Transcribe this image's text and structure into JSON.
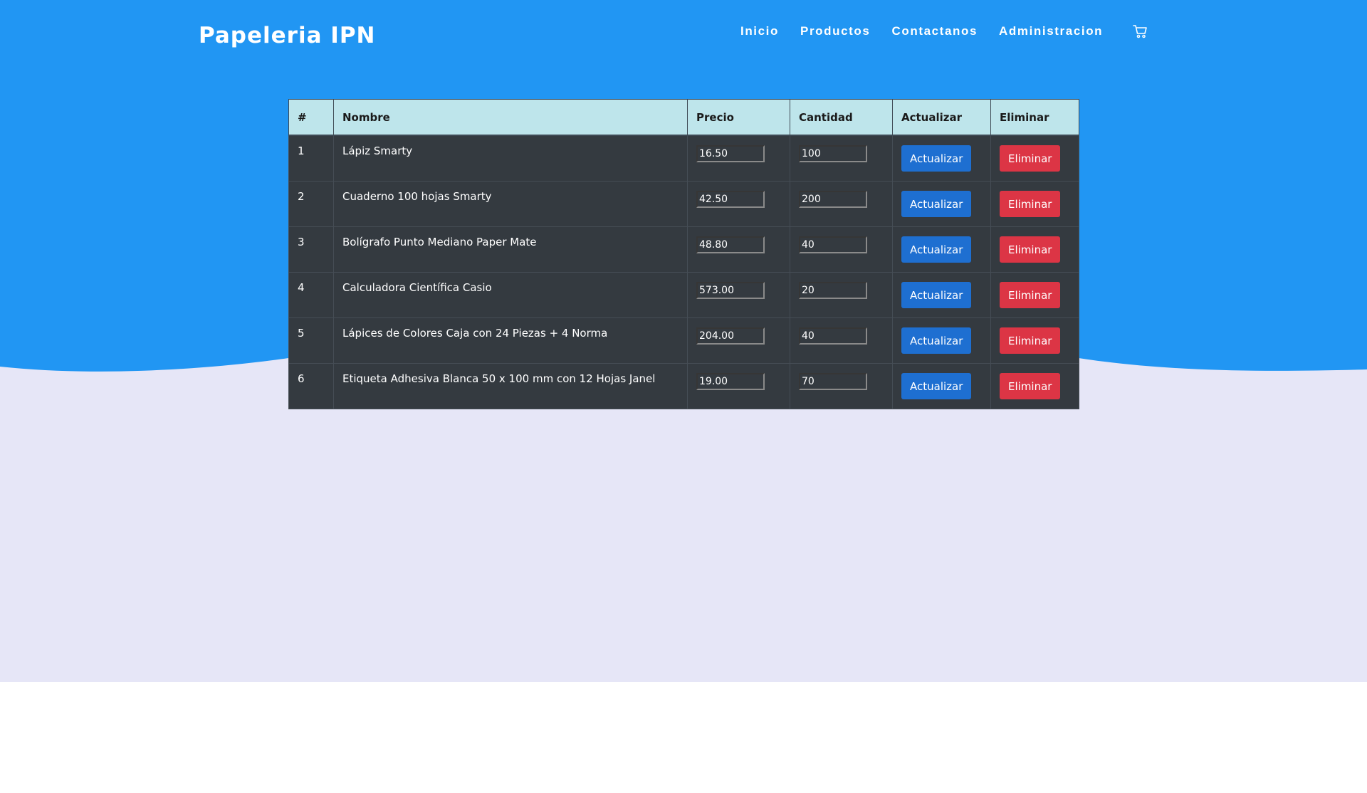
{
  "header": {
    "brand": "Papeleria IPN",
    "nav": [
      {
        "label": "Inicio"
      },
      {
        "label": "Productos"
      },
      {
        "label": "Contactanos"
      },
      {
        "label": "Administracion"
      }
    ],
    "cart_icon": "cart-icon"
  },
  "colors": {
    "header_blue": "#2196f3",
    "lavender_bg": "#e6e6f7",
    "table_dark": "#343a40",
    "table_head": "#bee5eb",
    "update_button": "#1e6fd1",
    "delete_button": "#dc3545"
  },
  "table": {
    "headers": {
      "index": "#",
      "name": "Nombre",
      "price": "Precio",
      "quantity": "Cantidad",
      "update": "Actualizar",
      "delete": "Eliminar"
    },
    "rows": [
      {
        "index": "1",
        "name": "Lápiz Smarty",
        "price": "16.50",
        "quantity": "100",
        "update": "Actualizar",
        "delete": "Eliminar"
      },
      {
        "index": "2",
        "name": "Cuaderno 100 hojas Smarty",
        "price": "42.50",
        "quantity": "200",
        "update": "Actualizar",
        "delete": "Eliminar"
      },
      {
        "index": "3",
        "name": "Bolígrafo Punto Mediano Paper Mate",
        "price": "48.80",
        "quantity": "40",
        "update": "Actualizar",
        "delete": "Eliminar"
      },
      {
        "index": "4",
        "name": "Calculadora Científica Casio",
        "price": "573.00",
        "quantity": "20",
        "update": "Actualizar",
        "delete": "Eliminar"
      },
      {
        "index": "5",
        "name": "Lápices de Colores Caja con 24 Piezas + 4 Norma",
        "price": "204.00",
        "quantity": "40",
        "update": "Actualizar",
        "delete": "Eliminar"
      },
      {
        "index": "6",
        "name": "Etiqueta Adhesiva Blanca 50 x 100 mm con 12 Hojas Janel",
        "price": "19.00",
        "quantity": "70",
        "update": "Actualizar",
        "delete": "Eliminar"
      }
    ]
  }
}
